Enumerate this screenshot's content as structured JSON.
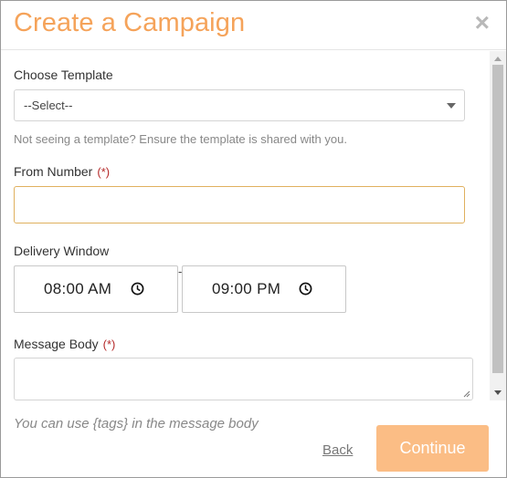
{
  "modal": {
    "title": "Create a Campaign",
    "close_label": "×"
  },
  "form": {
    "template": {
      "label": "Choose Template",
      "selected": "--Select--",
      "hint": "Not seeing a template? Ensure the template is shared with you."
    },
    "from_number": {
      "label": "From Number",
      "required_mark": "(*)",
      "value": ""
    },
    "delivery_window": {
      "label": "Delivery Window",
      "start": "08:00 AM",
      "separator": "-",
      "end": "09:00 PM"
    },
    "message_body": {
      "label": "Message Body",
      "required_mark": "(*)",
      "value": ""
    }
  },
  "footer": {
    "note": "You can use {tags} in the message body",
    "back_label": "Back",
    "continue_label": "Continue"
  },
  "colors": {
    "accent": "#f5a35a",
    "button": "#fbbd85",
    "required": "#b52a2a",
    "input_focus_border": "#e0b05e"
  }
}
